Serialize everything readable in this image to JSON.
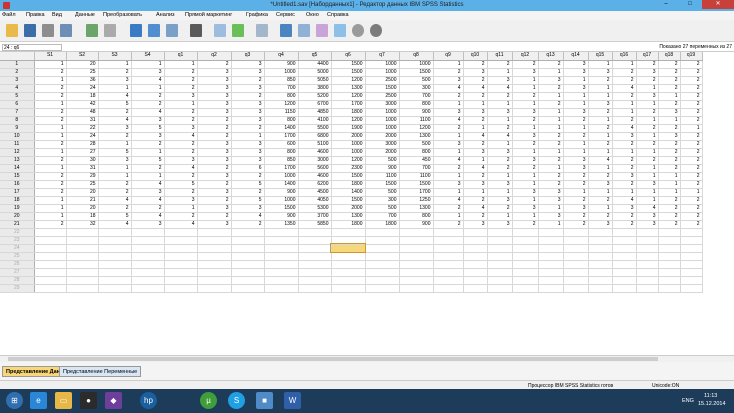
{
  "window": {
    "title": "*Untitled1.sav [Наборданных1] - Редактор данных IBM SPSS Statistics",
    "minimize": "–",
    "maximize": "□",
    "close": "✕"
  },
  "menu": [
    "Файл",
    "Правка",
    "Вид",
    "Данные",
    "Преобразовать",
    "Анализ",
    "Прямой маркетинг",
    "Графика",
    "Сервис",
    "Окно",
    "Справка"
  ],
  "cellbar": {
    "ref": "24 : q6",
    "visible": "Показано 27 переменных из 27"
  },
  "columns": [
    "S1",
    "S2",
    "S3",
    "S4",
    "q1",
    "q2",
    "q3",
    "q4",
    "q5",
    "q6",
    "q7",
    "q8",
    "q9",
    "q10",
    "q11",
    "q12",
    "q13",
    "q14",
    "q15",
    "q16",
    "q17",
    "q18",
    "q19"
  ],
  "rows": [
    [
      "1",
      "20",
      "1",
      "1",
      "1",
      "2",
      "3",
      "900",
      "4400",
      "1500",
      "1000",
      "1000",
      "1",
      "2",
      "2",
      "2",
      "2",
      "3",
      "1",
      "1",
      "2",
      "2",
      "2"
    ],
    [
      "2",
      "25",
      "2",
      "3",
      "2",
      "3",
      "3",
      "1000",
      "5000",
      "1500",
      "1000",
      "1500",
      "2",
      "3",
      "1",
      "3",
      "1",
      "3",
      "3",
      "2",
      "3",
      "2",
      "2"
    ],
    [
      "1",
      "36",
      "3",
      "4",
      "2",
      "3",
      "2",
      "850",
      "5050",
      "1200",
      "2500",
      "500",
      "3",
      "2",
      "3",
      "1",
      "3",
      "1",
      "2",
      "2",
      "2",
      "2",
      "2"
    ],
    [
      "2",
      "24",
      "1",
      "1",
      "2",
      "3",
      "3",
      "700",
      "3800",
      "1300",
      "1500",
      "300",
      "4",
      "4",
      "4",
      "1",
      "2",
      "3",
      "1",
      "4",
      "1",
      "2",
      "2"
    ],
    [
      "2",
      "18",
      "4",
      "2",
      "3",
      "3",
      "2",
      "800",
      "5200",
      "1200",
      "2500",
      "700",
      "2",
      "2",
      "2",
      "2",
      "1",
      "1",
      "1",
      "2",
      "3",
      "1",
      "2"
    ],
    [
      "1",
      "42",
      "5",
      "2",
      "1",
      "3",
      "3",
      "1200",
      "6700",
      "1700",
      "3000",
      "800",
      "1",
      "1",
      "1",
      "1",
      "2",
      "1",
      "3",
      "1",
      "1",
      "2",
      "2"
    ],
    [
      "2",
      "48",
      "2",
      "4",
      "2",
      "3",
      "3",
      "1150",
      "4850",
      "1800",
      "1000",
      "900",
      "3",
      "3",
      "3",
      "3",
      "1",
      "3",
      "2",
      "1",
      "2",
      "3",
      "2"
    ],
    [
      "2",
      "31",
      "4",
      "3",
      "2",
      "2",
      "3",
      "800",
      "4100",
      "1200",
      "1000",
      "1100",
      "4",
      "2",
      "1",
      "2",
      "1",
      "2",
      "1",
      "2",
      "1",
      "1",
      "2"
    ],
    [
      "1",
      "22",
      "3",
      "5",
      "3",
      "2",
      "2",
      "1400",
      "5500",
      "1900",
      "1000",
      "1200",
      "2",
      "1",
      "2",
      "1",
      "1",
      "1",
      "2",
      "4",
      "2",
      "2",
      "1"
    ],
    [
      "1",
      "24",
      "2",
      "3",
      "4",
      "2",
      "1",
      "1700",
      "6800",
      "2000",
      "2000",
      "1300",
      "1",
      "4",
      "4",
      "3",
      "2",
      "2",
      "1",
      "3",
      "1",
      "3",
      "2"
    ],
    [
      "2",
      "28",
      "1",
      "2",
      "2",
      "3",
      "3",
      "600",
      "5100",
      "1000",
      "3000",
      "500",
      "3",
      "2",
      "1",
      "2",
      "2",
      "1",
      "2",
      "2",
      "2",
      "2",
      "2"
    ],
    [
      "1",
      "27",
      "5",
      "1",
      "2",
      "3",
      "3",
      "800",
      "4600",
      "1000",
      "2000",
      "800",
      "1",
      "3",
      "3",
      "1",
      "1",
      "1",
      "1",
      "1",
      "1",
      "2",
      "2"
    ],
    [
      "2",
      "30",
      "3",
      "5",
      "3",
      "3",
      "3",
      "850",
      "3000",
      "1200",
      "500",
      "450",
      "4",
      "1",
      "2",
      "3",
      "2",
      "3",
      "4",
      "2",
      "2",
      "2",
      "2"
    ],
    [
      "1",
      "31",
      "1",
      "2",
      "4",
      "2",
      "6",
      "1700",
      "5600",
      "2300",
      "900",
      "700",
      "2",
      "4",
      "2",
      "2",
      "1",
      "3",
      "1",
      "2",
      "1",
      "2",
      "2"
    ],
    [
      "2",
      "29",
      "1",
      "1",
      "2",
      "3",
      "2",
      "1000",
      "4600",
      "1500",
      "1100",
      "1100",
      "1",
      "2",
      "1",
      "1",
      "2",
      "2",
      "2",
      "3",
      "1",
      "1",
      "2"
    ],
    [
      "2",
      "25",
      "2",
      "4",
      "5",
      "2",
      "5",
      "1400",
      "6200",
      "1800",
      "1500",
      "1500",
      "3",
      "3",
      "3",
      "1",
      "2",
      "2",
      "3",
      "2",
      "3",
      "1",
      "2"
    ],
    [
      "2",
      "20",
      "2",
      "3",
      "2",
      "3",
      "2",
      "900",
      "4500",
      "1400",
      "500",
      "1700",
      "1",
      "1",
      "1",
      "3",
      "3",
      "1",
      "1",
      "1",
      "1",
      "1",
      "1"
    ],
    [
      "1",
      "21",
      "4",
      "4",
      "3",
      "2",
      "5",
      "1000",
      "4050",
      "1500",
      "300",
      "1250",
      "4",
      "2",
      "3",
      "1",
      "3",
      "2",
      "2",
      "4",
      "1",
      "2",
      "2"
    ],
    [
      "1",
      "20",
      "2",
      "2",
      "1",
      "3",
      "3",
      "1500",
      "5300",
      "2000",
      "500",
      "1300",
      "2",
      "4",
      "2",
      "3",
      "1",
      "3",
      "1",
      "3",
      "4",
      "2",
      "2"
    ],
    [
      "1",
      "18",
      "5",
      "4",
      "2",
      "2",
      "4",
      "900",
      "3700",
      "1300",
      "700",
      "800",
      "1",
      "2",
      "1",
      "1",
      "3",
      "2",
      "2",
      "2",
      "3",
      "2",
      "2"
    ],
    [
      "2",
      "32",
      "4",
      "3",
      "4",
      "3",
      "2",
      "1350",
      "5850",
      "1800",
      "1800",
      "900",
      "2",
      "3",
      "3",
      "2",
      "1",
      "2",
      "3",
      "2",
      "3",
      "2",
      "2"
    ]
  ],
  "empty_rows": [
    "22",
    "23",
    "24",
    "25",
    "26",
    "27",
    "28",
    "29"
  ],
  "tabs": {
    "data_view": "Представление Данные",
    "variable_view": "Представление Переменные"
  },
  "status": {
    "processor": "Процессор IBM SPSS Statistics  готов",
    "unicode": "Unicode:ON"
  },
  "taskbar": {
    "time": "11:13",
    "date": "15.12.2014",
    "lang": "ENG"
  }
}
